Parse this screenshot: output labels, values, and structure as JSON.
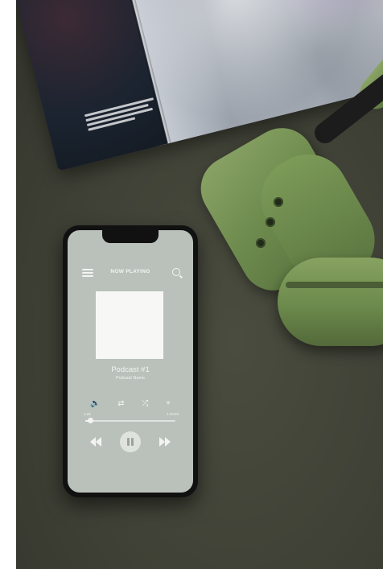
{
  "scene": {
    "description_items": [
      "magazine",
      "smartphone",
      "headphones"
    ]
  },
  "player": {
    "header_title": "NOW PLAYING",
    "track_title": "Podcast #1",
    "track_subtitle": "Podcast Name",
    "time_elapsed": "1:25",
    "time_total": "1:23:32",
    "progress_fraction": 0.05,
    "controls": [
      "volume-icon",
      "repeat-icon",
      "shuffle-icon",
      "add-icon"
    ],
    "transport": [
      "previous-icon",
      "pause-icon",
      "next-icon"
    ]
  },
  "colors": {
    "screen": "#b9c1ba",
    "headphones": "#6f8c4f",
    "surface": "#3f4136"
  }
}
